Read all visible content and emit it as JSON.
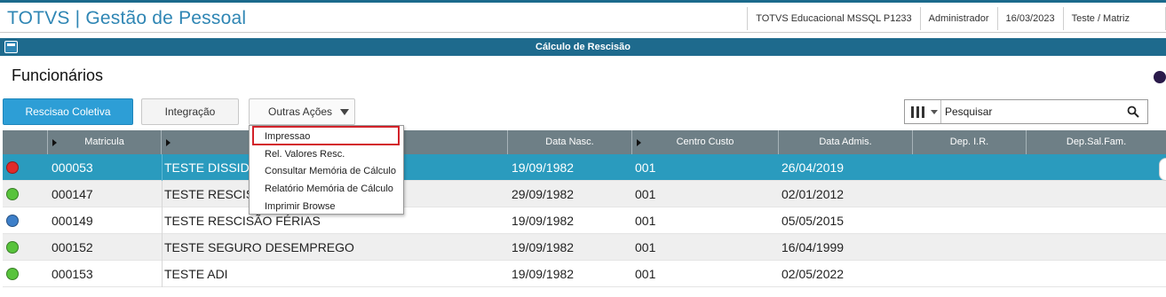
{
  "app": {
    "title": "TOTVS | Gestão de Pessoal",
    "environment": "TOTVS Educacional MSSQL P1233",
    "user": "Administrador",
    "date": "16/03/2023",
    "branch": "Teste / Matriz"
  },
  "window": {
    "title": "Cálculo de Rescisão"
  },
  "section": {
    "title": "Funcionários"
  },
  "toolbar": {
    "rescisao_coletiva": "Rescisao Coletiva",
    "integracao": "Integração",
    "outras_acoes": "Outras Ações"
  },
  "search": {
    "placeholder": "Pesquisar"
  },
  "menu": {
    "items": [
      {
        "label": "Impressao"
      },
      {
        "label": "Rel. Valores Resc."
      },
      {
        "label": "Consultar Memória de Cálculo"
      },
      {
        "label": "Relatório Memória de Cálculo"
      },
      {
        "label": "Imprimir Browse"
      }
    ]
  },
  "grid": {
    "columns": [
      "Matricula",
      "",
      "Data Nasc.",
      "Centro Custo",
      "Data Admis.",
      "Dep. I.R.",
      "Dep.Sal.Fam."
    ],
    "rows": [
      {
        "status_color": "#e02a2a",
        "matricula": "000053",
        "nome": "TESTE DISSID",
        "data_nasc": "19/09/1982",
        "centro_custo": "001",
        "data_admis": "26/04/2019"
      },
      {
        "status_color": "#58c33c",
        "matricula": "000147",
        "nome": "TESTE RESCIS",
        "data_nasc": "29/09/1982",
        "centro_custo": "001",
        "data_admis": "02/01/2012"
      },
      {
        "status_color": "#3d7fc9",
        "matricula": "000149",
        "nome": "TESTE RESCISÃO FÉRIAS",
        "data_nasc": "19/09/1982",
        "centro_custo": "001",
        "data_admis": "05/05/2015"
      },
      {
        "status_color": "#58c33c",
        "matricula": "000152",
        "nome": "TESTE SEGURO DESEMPREGO",
        "data_nasc": "19/09/1982",
        "centro_custo": "001",
        "data_admis": "16/04/1999"
      },
      {
        "status_color": "#58c33c",
        "matricula": "000153",
        "nome": "TESTE ADI",
        "data_nasc": "19/09/1982",
        "centro_custo": "001",
        "data_admis": "02/05/2022"
      }
    ]
  },
  "colors": {
    "accent": "#2d9ed6",
    "header": "#1e6a8d",
    "grid_header": "#6e7f86",
    "selected_row": "#2a9bbe",
    "highlight": "#d3222a"
  }
}
